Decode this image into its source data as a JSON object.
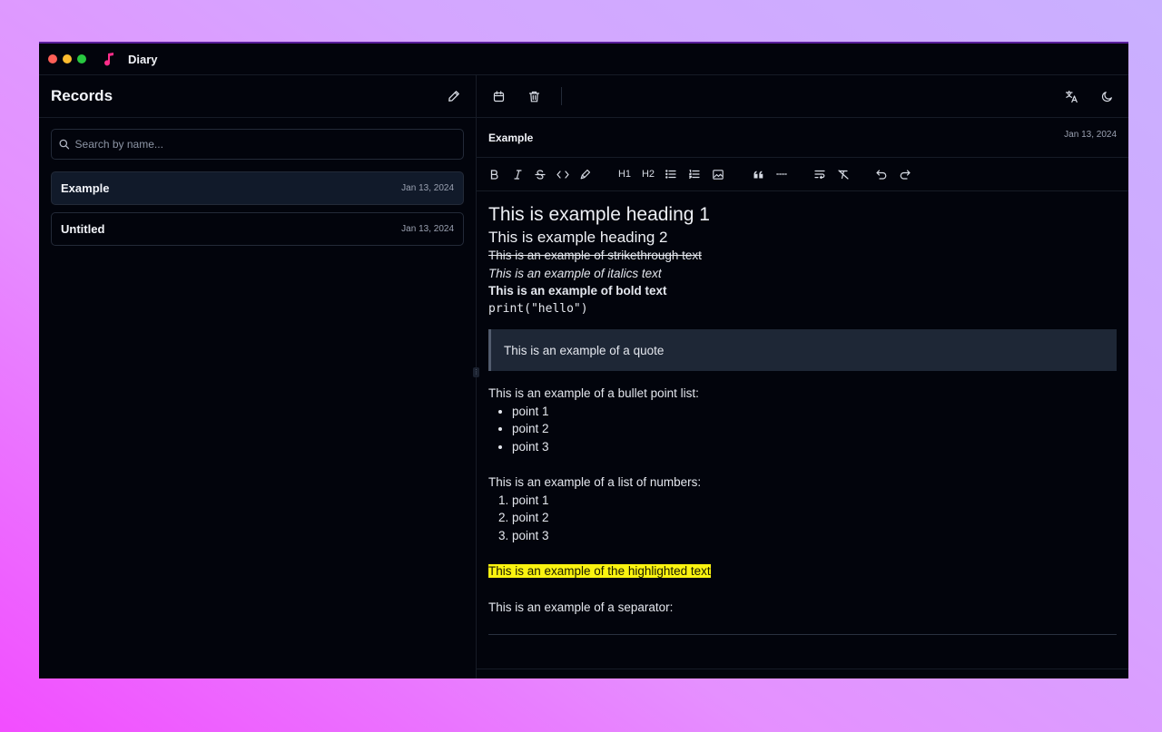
{
  "app": {
    "title": "Diary"
  },
  "sidebar": {
    "title": "Records",
    "search_placeholder": "Search by name...",
    "records": [
      {
        "name": "Example",
        "date": "Jan 13, 2024",
        "active": true
      },
      {
        "name": "Untitled",
        "date": "Jan 13, 2024",
        "active": false
      }
    ]
  },
  "note": {
    "title": "Example",
    "date": "Jan 13, 2024"
  },
  "toolbar": {
    "h1_label": "H1",
    "h2_label": "H2"
  },
  "content": {
    "heading1": "This is example heading 1",
    "heading2": "This is example heading 2",
    "strike": "This is an example of strikethrough text",
    "italic": "This is an example of italics text",
    "bold": "This is an example of bold text",
    "code": "print(\"hello\")",
    "quote": "This is an example of a quote",
    "bullet_intro": "This is an example of a bullet point list:",
    "bullets": [
      "point 1",
      "point 2",
      "point 3"
    ],
    "numbers_intro": "This is an example of a list of numbers:",
    "numbers": [
      "point 1",
      "point 2",
      "point 3"
    ],
    "highlight": "This is an example of the highlighted text",
    "separator_intro": "This is an example of a separator:"
  },
  "colors": {
    "highlight": "#faf310",
    "accent_icon": "#ff2d8a",
    "window_bg": "#02040c"
  }
}
